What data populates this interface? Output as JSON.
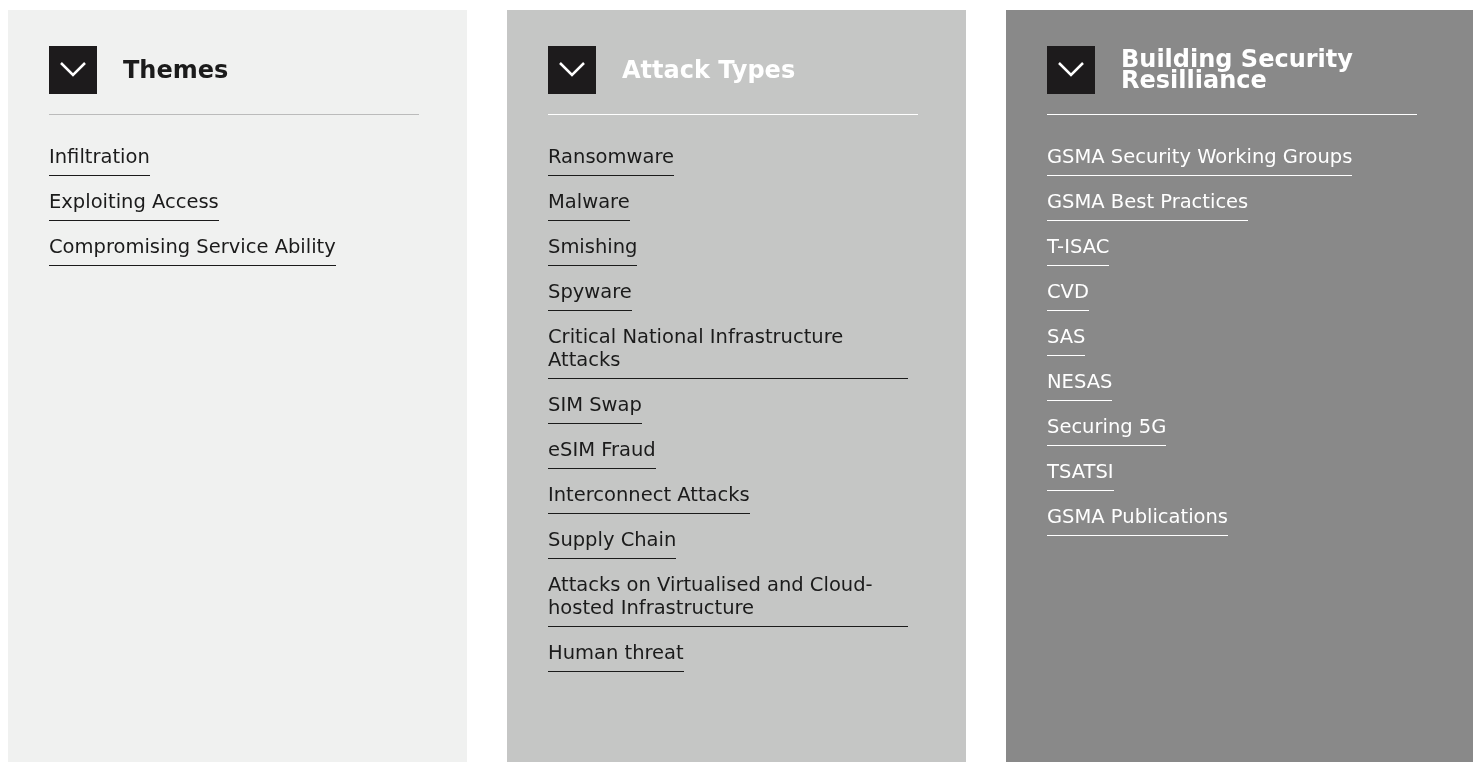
{
  "panels": [
    {
      "kind": "light",
      "title": "Themes",
      "expanded": true,
      "links": [
        "Infiltration",
        "Exploiting Access",
        "Compromising Service Ability"
      ]
    },
    {
      "kind": "medium",
      "title": "Attack Types",
      "expanded": true,
      "links": [
        "Ransomware",
        "Malware",
        "Smishing",
        "Spyware",
        "Critical National Infrastructure Attacks",
        "SIM Swap",
        "eSIM Fraud",
        "Interconnect Attacks",
        "Supply Chain",
        "Attacks on Virtualised and Cloud-hosted Infrastructure",
        "Human threat"
      ]
    },
    {
      "kind": "dark",
      "title": "Building Security Resilliance",
      "expanded": true,
      "links": [
        "GSMA Security Working Groups",
        "GSMA Best Practices",
        "T-ISAC",
        "CVD",
        "SAS",
        "NESAS",
        "Securing 5G",
        "TSATSI",
        "GSMA Publications"
      ]
    }
  ]
}
